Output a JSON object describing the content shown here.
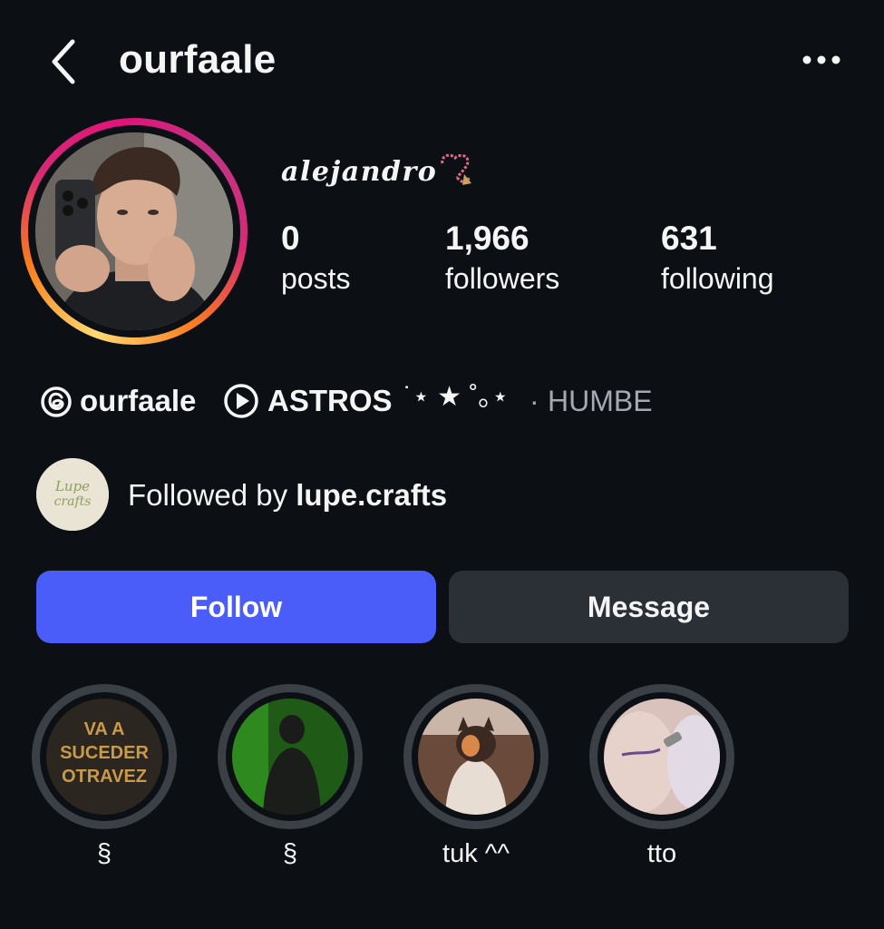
{
  "header": {
    "username": "ourfaale"
  },
  "profile": {
    "display_name": "alejandro",
    "stats": [
      {
        "value": "0",
        "label": "posts"
      },
      {
        "value": "1,966",
        "label": "followers"
      },
      {
        "value": "631",
        "label": "following"
      }
    ],
    "threads_handle": "ourfaale",
    "song": {
      "title": "ASTROS",
      "decoration": "˙⋆ ★ ˚｡⋆",
      "separator": "·",
      "artist": "HUMBE"
    },
    "followed_by": {
      "prefix": "Followed by",
      "user": "lupe.crafts",
      "avatar_text": "Lupe crafts"
    }
  },
  "actions": {
    "follow_label": "Follow",
    "message_label": "Message"
  },
  "highlights": [
    {
      "label": "§",
      "cover_text": "VA A SUCEDER OTRAVEZ"
    },
    {
      "label": "§"
    },
    {
      "label": "tuk ^^"
    },
    {
      "label": "tto"
    }
  ],
  "colors": {
    "background": "#0c1014",
    "follow_button": "#4a5df9",
    "message_button": "#2b3036",
    "secondary_text": "#a8a8b3"
  }
}
